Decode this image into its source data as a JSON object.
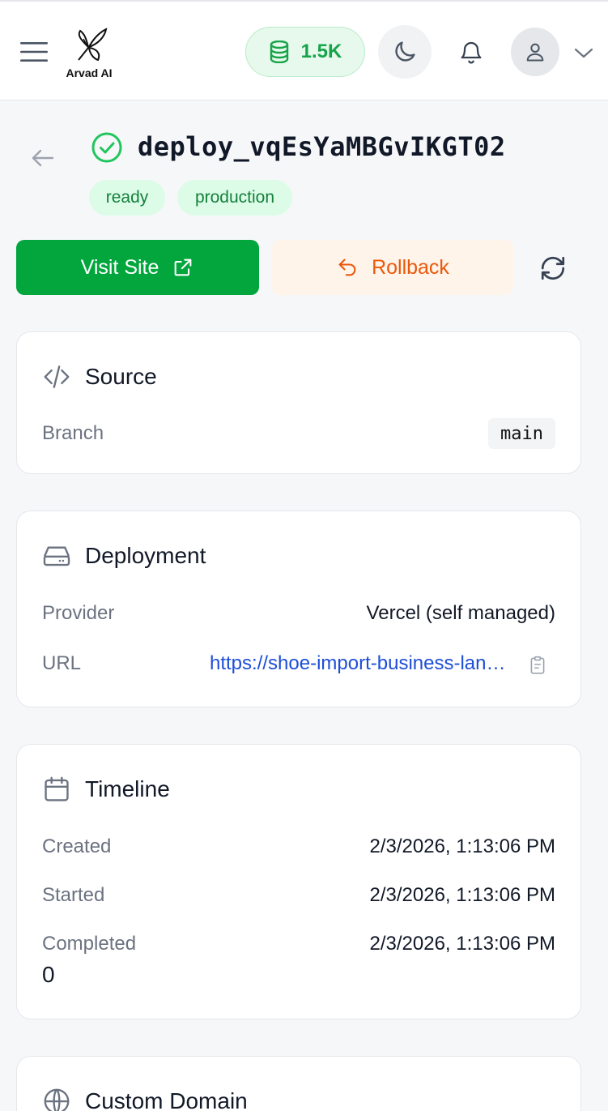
{
  "header": {
    "logo_text": "Arvad AI",
    "credits": "1.5K"
  },
  "deployment": {
    "id": "deploy_vqEsYaMBGvIKGT02",
    "status_badge": "ready",
    "environment_badge": "production",
    "actions": {
      "visit_label": "Visit Site",
      "rollback_label": "Rollback"
    }
  },
  "source": {
    "title": "Source",
    "branch_label": "Branch",
    "branch_value": "main"
  },
  "deployment_info": {
    "title": "Deployment",
    "provider_label": "Provider",
    "provider_value": "Vercel (self managed)",
    "url_label": "URL",
    "url_value": "https://shoe-import-business-landing-page.vercel.app"
  },
  "timeline": {
    "title": "Timeline",
    "created_label": "Created",
    "created_value": "2/3/2026, 1:13:06 PM",
    "started_label": "Started",
    "started_value": "2/3/2026, 1:13:06 PM",
    "completed_label": "Completed",
    "completed_value": "2/3/2026, 1:13:06 PM",
    "duration_value": "0"
  },
  "custom_domain": {
    "title": "Custom Domain"
  },
  "colors": {
    "primary_green": "#02a63c",
    "rollback_orange": "#ea580c",
    "link_blue": "#1d4ed8"
  }
}
